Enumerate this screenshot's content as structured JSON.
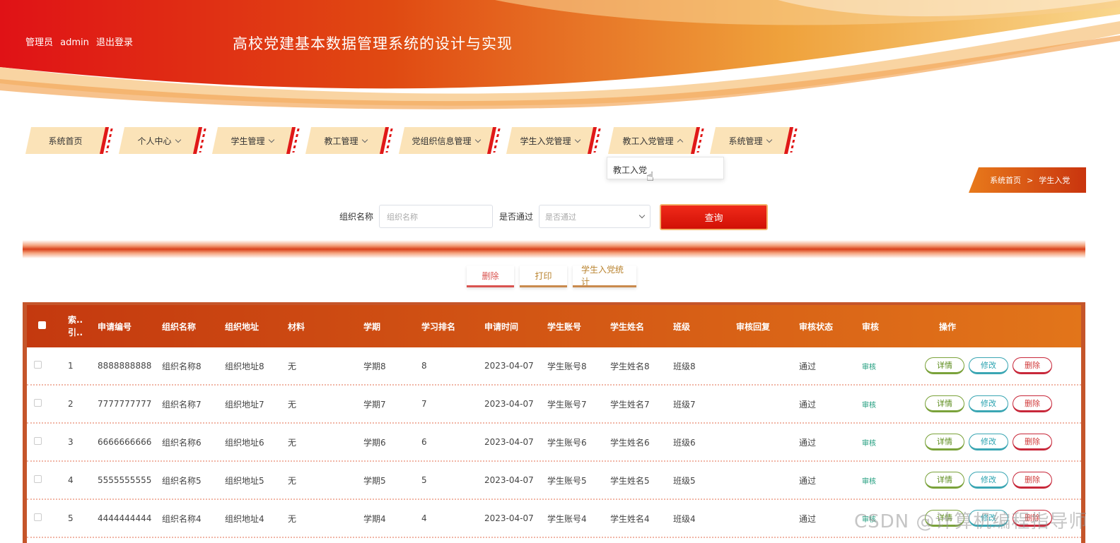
{
  "header": {
    "role": "管理员",
    "username": "admin",
    "logout_label": "退出登录",
    "system_title": "高校党建基本数据管理系统的设计与实现"
  },
  "nav": {
    "items": [
      {
        "label": "系统首页",
        "has_caret": false
      },
      {
        "label": "个人中心",
        "has_caret": true
      },
      {
        "label": "学生管理",
        "has_caret": true
      },
      {
        "label": "教工管理",
        "has_caret": true
      },
      {
        "label": "党组织信息管理",
        "has_caret": true
      },
      {
        "label": "学生入党管理",
        "has_caret": true
      },
      {
        "label": "教工入党管理",
        "has_caret": true,
        "open": true
      },
      {
        "label": "系统管理",
        "has_caret": true
      }
    ],
    "dropdown_item": "教工入党"
  },
  "breadcrumb": {
    "home": "系统首页",
    "separator": ">",
    "current": "学生入党"
  },
  "search": {
    "org_label": "组织名称",
    "org_placeholder": "组织名称",
    "pass_label": "是否通过",
    "pass_placeholder": "是否通过",
    "query_label": "查询"
  },
  "actions": {
    "delete": "删除",
    "print": "打印",
    "stats": "学生入党统计"
  },
  "table": {
    "headers": [
      "索引",
      "申请编号",
      "组织名称",
      "组织地址",
      "材料",
      "学期",
      "学习排名",
      "申请时间",
      "学生账号",
      "学生姓名",
      "班级",
      "审核回复",
      "审核状态",
      "审核",
      "操作"
    ],
    "index_header_top": "索..",
    "index_header_bottom": "引..",
    "rows": [
      {
        "index": "1",
        "app_no": "8888888888",
        "org": "组织名称8",
        "addr": "组织地址8",
        "material": "无",
        "term": "学期8",
        "rank": "8",
        "date": "2023-04-07",
        "account": "学生账号8",
        "name": "学生姓名8",
        "class": "班级8",
        "reply": "",
        "status": "通过",
        "audit": "审核"
      },
      {
        "index": "2",
        "app_no": "7777777777",
        "org": "组织名称7",
        "addr": "组织地址7",
        "material": "无",
        "term": "学期7",
        "rank": "7",
        "date": "2023-04-07",
        "account": "学生账号7",
        "name": "学生姓名7",
        "class": "班级7",
        "reply": "",
        "status": "通过",
        "audit": "审核"
      },
      {
        "index": "3",
        "app_no": "6666666666",
        "org": "组织名称6",
        "addr": "组织地址6",
        "material": "无",
        "term": "学期6",
        "rank": "6",
        "date": "2023-04-07",
        "account": "学生账号6",
        "name": "学生姓名6",
        "class": "班级6",
        "reply": "",
        "status": "通过",
        "audit": "审核"
      },
      {
        "index": "4",
        "app_no": "5555555555",
        "org": "组织名称5",
        "addr": "组织地址5",
        "material": "无",
        "term": "学期5",
        "rank": "5",
        "date": "2023-04-07",
        "account": "学生账号5",
        "name": "学生姓名5",
        "class": "班级5",
        "reply": "",
        "status": "通过",
        "audit": "审核"
      },
      {
        "index": "5",
        "app_no": "4444444444",
        "org": "组织名称4",
        "addr": "组织地址4",
        "material": "无",
        "term": "学期4",
        "rank": "4",
        "date": "2023-04-07",
        "account": "学生账号4",
        "name": "学生姓名4",
        "class": "班级4",
        "reply": "",
        "status": "通过",
        "audit": "审核"
      }
    ],
    "row_buttons": {
      "detail": "详情",
      "edit": "修改",
      "delete": "删除"
    }
  },
  "watermark": "CSDN @计算机编程指导师"
}
